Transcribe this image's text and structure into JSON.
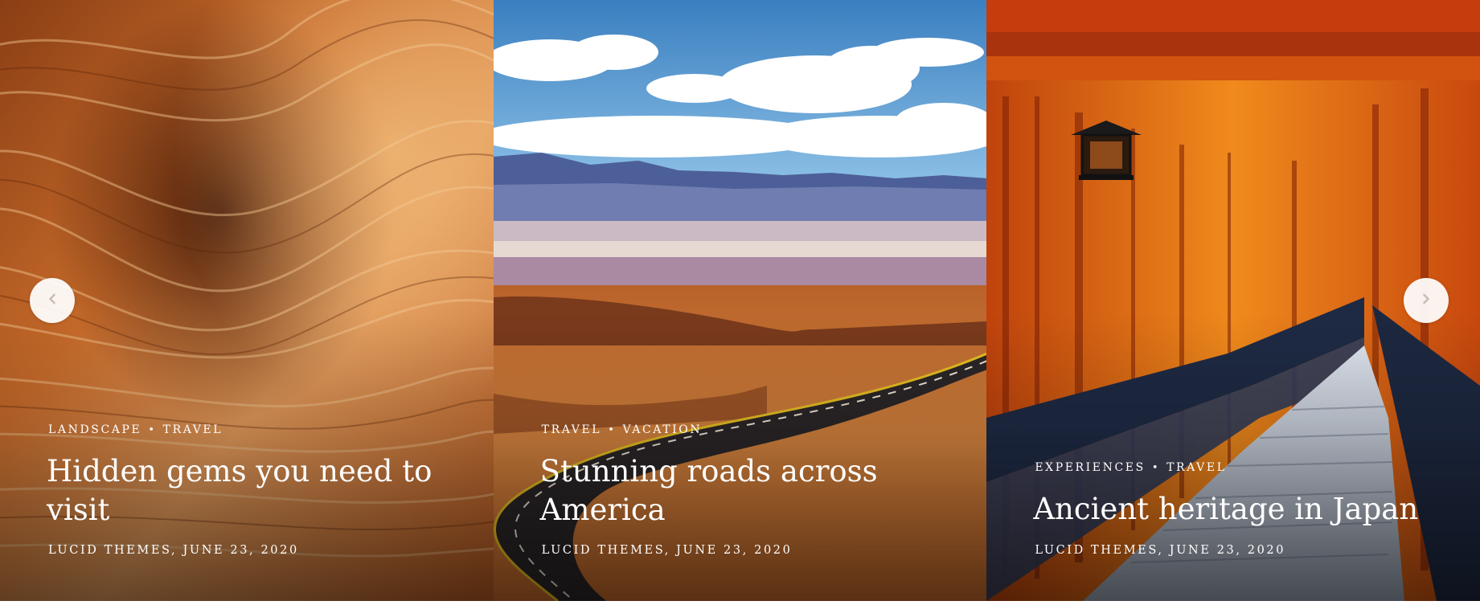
{
  "slides": [
    {
      "image": "orange-sandstone-wave-canyon",
      "categories": [
        "LANDSCAPE",
        "TRAVEL"
      ],
      "separator": "•",
      "title": "Hidden gems you need to visit",
      "meta": "LUCID THEMES, JUNE 23, 2020"
    },
    {
      "image": "desert-winding-road-mountains",
      "categories": [
        "TRAVEL",
        "VACATION"
      ],
      "separator": "•",
      "title": "Stunning roads across America",
      "meta": "LUCID THEMES, JUNE 23, 2020"
    },
    {
      "image": "torii-gates-tunnel-japan",
      "categories": [
        "EXPERIENCES",
        "TRAVEL"
      ],
      "separator": "•",
      "title": "Ancient heritage in Japan",
      "meta": "LUCID THEMES, JUNE 23, 2020"
    }
  ],
  "controls": {
    "prev_icon": "chevron-left-icon",
    "next_icon": "chevron-right-icon"
  },
  "colors": {
    "overlay_text": "#ffffff",
    "arrow_bg": "#ffffff",
    "arrow_glyph": "#c9bdb8"
  }
}
